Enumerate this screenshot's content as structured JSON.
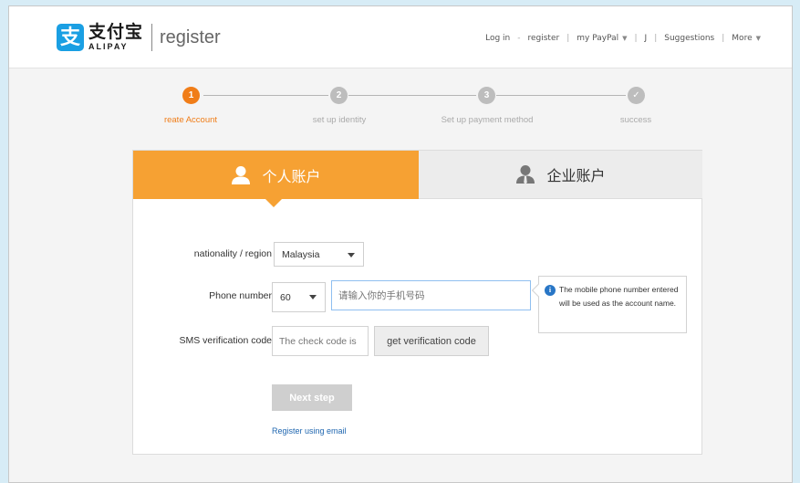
{
  "header": {
    "logo_glyph": "支",
    "logo_cn": "支付宝",
    "logo_en": "ALIPAY",
    "page_name": "register",
    "nav": {
      "login": "Log in",
      "dash": "-",
      "register": "register",
      "my_paypal": "my PayPal",
      "j": "J",
      "suggestions": "Suggestions",
      "more": "More",
      "separator": "|",
      "caret": "▼"
    }
  },
  "steps": [
    {
      "number": "1",
      "label": "reate Account",
      "state": "active"
    },
    {
      "number": "2",
      "label": "set up identity",
      "state": "pending"
    },
    {
      "number": "3",
      "label": "Set up payment method",
      "state": "pending"
    },
    {
      "number": "✓",
      "label": "success",
      "state": "pending"
    }
  ],
  "tabs": {
    "personal": "个人账户",
    "business": "企业账户",
    "personal_icon": "user-icon",
    "business_icon": "business-user-icon"
  },
  "form": {
    "nationality_label": "nationality / region",
    "nationality_value": "Malaysia",
    "phone_label": "Phone number",
    "country_code": "60",
    "phone_placeholder": "请输入你的手机号码",
    "sms_label": "SMS verification code",
    "sms_placeholder": "The check code is",
    "get_code_button": "get verification code",
    "tooltip_icon": "i",
    "tooltip": "The mobile phone number entered will be used as the account name.",
    "next_button": "Next step",
    "email_link": "Register using email"
  },
  "colors": {
    "accent_orange": "#f6a133",
    "step_active": "#f07d18",
    "brand_blue": "#1a9fe3",
    "link_blue": "#2067b0",
    "background": "#d7ecf6"
  }
}
